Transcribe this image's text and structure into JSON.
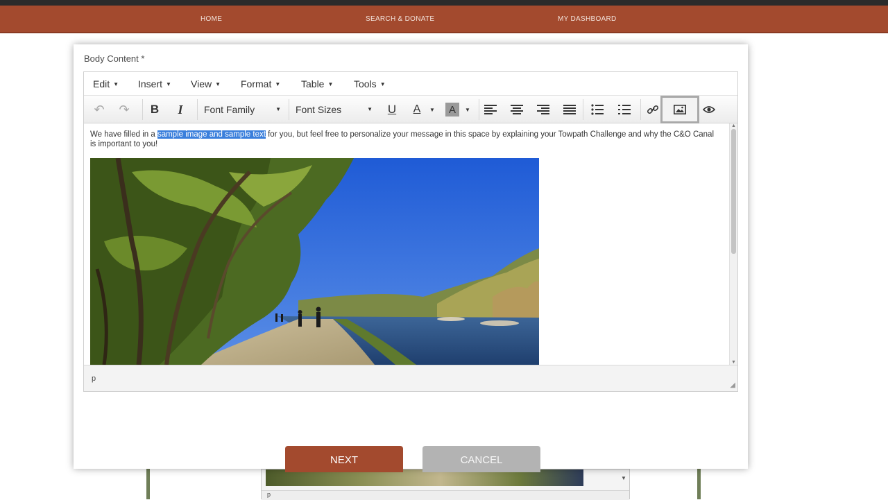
{
  "nav": {
    "home": "HOME",
    "search_donate": "SEARCH & DONATE",
    "dashboard": "MY DASHBOARD"
  },
  "modal": {
    "field_label": "Body Content *",
    "menus": [
      "Edit",
      "Insert",
      "View",
      "Format",
      "Table",
      "Tools"
    ],
    "toolbar": {
      "font_family": "Font Family",
      "font_sizes": "Font Sizes",
      "icons": [
        "undo-icon",
        "redo-icon",
        "bold-icon",
        "italic-icon",
        "underline-icon",
        "text-color-icon",
        "background-color-icon",
        "align-left-icon",
        "align-center-icon",
        "align-right-icon",
        "align-justify-icon",
        "bullet-list-icon",
        "numbered-list-icon",
        "link-icon",
        "image-icon",
        "preview-icon"
      ],
      "bold": "B",
      "italic": "I",
      "underline": "U",
      "text_color": "A",
      "bg_color": "A"
    },
    "content": {
      "before": "We have filled in a ",
      "highlight": "sample image and sample text",
      "after": " for you, but feel free to personalize your message in this space by explaining your Towpath Challenge and why the C&O Canal is important to you!"
    },
    "path": "p",
    "buttons": {
      "next": "NEXT",
      "cancel": "CANCEL"
    }
  },
  "background": {
    "path": "p"
  },
  "colors": {
    "brand": "#a34a2e",
    "highlight": "#3a7fdc",
    "cancel": "#b3b3b3"
  }
}
